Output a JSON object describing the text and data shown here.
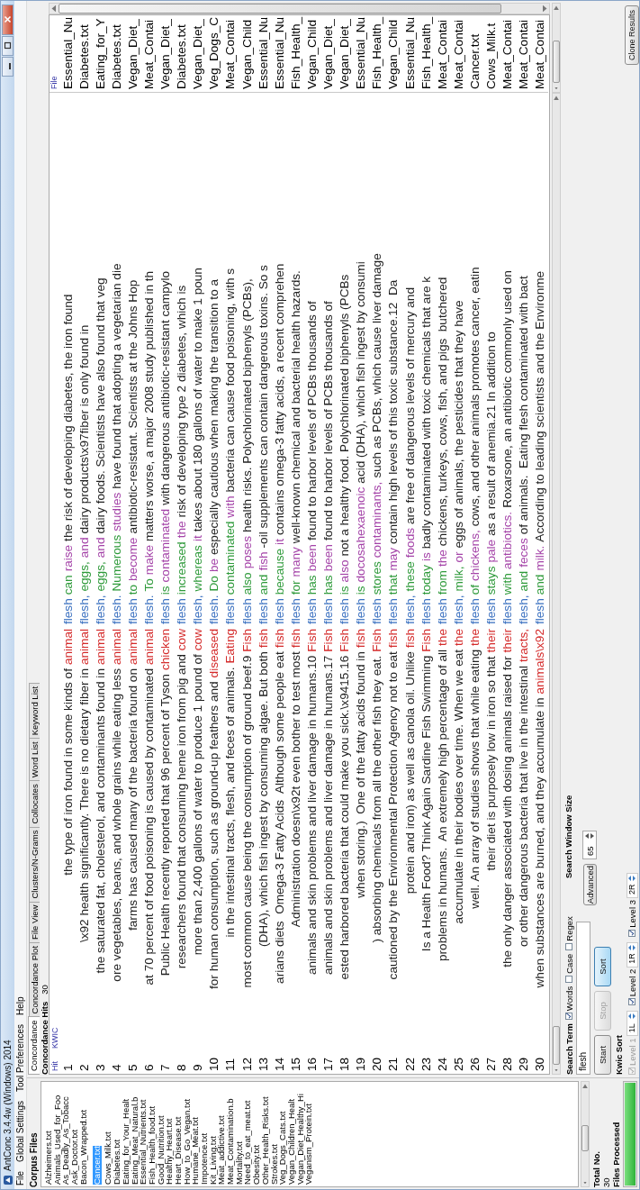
{
  "window": {
    "title": "AntConc 3.4.4w (Windows) 2014"
  },
  "menu": [
    "File",
    "Global Settings",
    "Tool Preferences",
    "Help"
  ],
  "corpus_files": {
    "label": "Corpus Files",
    "items": [
      {
        "name": "Alzheimers.txt",
        "selected": false
      },
      {
        "name": "Animals_Used_for_Foo",
        "selected": false
      },
      {
        "name": "As_Deadly_As_Tobacc",
        "selected": false
      },
      {
        "name": "Ask_Doctor.txt",
        "selected": false
      },
      {
        "name": "Bacon_Wrapped.txt",
        "selected": false
      },
      {
        "name": "Cancer.txt",
        "selected": true
      },
      {
        "name": "Cows_Milk.txt",
        "selected": false
      },
      {
        "name": "Diabetes.txt",
        "selected": false
      },
      {
        "name": "Eating_for_Your_Healt",
        "selected": false
      },
      {
        "name": "Eating_Meat_Natural.b",
        "selected": false
      },
      {
        "name": "Essential_Nutrients.txt",
        "selected": false
      },
      {
        "name": "Fish_Health_food.txt",
        "selected": false
      },
      {
        "name": "Good_Nutrition.txt",
        "selected": false
      },
      {
        "name": "Healthy_Heart.txt",
        "selected": false
      },
      {
        "name": "Heart_Disease.txt",
        "selected": false
      },
      {
        "name": "How_to_Go_Vegan.txt",
        "selected": false
      },
      {
        "name": "Humane_Meat.txt",
        "selected": false
      },
      {
        "name": "Impotence.txt",
        "selected": false
      },
      {
        "name": "Kit_Living.txt",
        "selected": false
      },
      {
        "name": "Meat_addictive.txt",
        "selected": false
      },
      {
        "name": "Meat_Contamination.b",
        "selected": false
      },
      {
        "name": "Mortality.txt",
        "selected": false
      },
      {
        "name": "Need_to_eat_meat.txt",
        "selected": false
      },
      {
        "name": "Obesity.txt",
        "selected": false
      },
      {
        "name": "Other_Health_Risks.txt",
        "selected": false
      },
      {
        "name": "Strokes.txt",
        "selected": false
      },
      {
        "name": "Veg_Dogs_Cats.txt",
        "selected": false
      },
      {
        "name": "Vegan_Children_Healt",
        "selected": false
      },
      {
        "name": "Vegan_Diet_Healthy_Hi",
        "selected": false
      },
      {
        "name": "Veganism_Protein.txt",
        "selected": false
      }
    ]
  },
  "totals": {
    "total_label": "Total No.",
    "total": "30",
    "processed_label": "Files Processed",
    "progress": {
      "level": 1
    }
  },
  "tabs": [
    {
      "label": "Concordance",
      "selected": true
    },
    {
      "label": "Concordance Plot",
      "selected": false
    },
    {
      "label": "File View",
      "selected": false
    },
    {
      "label": "Clusters/N-Grams",
      "selected": false
    },
    {
      "label": "Collocates",
      "selected": false
    },
    {
      "label": "Word List",
      "selected": false
    },
    {
      "label": "Keyword List",
      "selected": false
    }
  ],
  "concordance": {
    "hits_label": "Concordance Hits",
    "hits": "30",
    "columns": {
      "hit": "Hit",
      "kwic": "KWIC",
      "file": "File"
    },
    "rows": [
      {
        "hit": "1",
        "file": "Essential_Nu",
        "segments": [
          {
            "kind": "plain",
            "text": "the type of iron found in some kinds of"
          },
          {
            "kind": "l1",
            "text": "animal"
          },
          {
            "kind": "node",
            "text": "flesh"
          },
          {
            "kind": "r1",
            "text": "can"
          },
          {
            "kind": "r2",
            "text": "raise"
          },
          {
            "kind": "plain",
            "text": "the risk of developing diabetes, the iron found"
          }
        ]
      },
      {
        "hit": "2",
        "file": "Diabetes.txt",
        "segments": [
          {
            "kind": "plain",
            "text": "\\x92 health significantly. There is no dietary fiber in"
          },
          {
            "kind": "l1",
            "text": "animal"
          },
          {
            "kind": "node",
            "text": "flesh,"
          },
          {
            "kind": "r1",
            "text": "eggs,"
          },
          {
            "kind": "r2",
            "text": "and"
          },
          {
            "kind": "plain",
            "text": "dairy products\\x97fiber is only found in"
          }
        ]
      },
      {
        "hit": "3",
        "file": "Eating_for_Y",
        "segments": [
          {
            "kind": "plain",
            "text": "the saturated fat, cholesterol, and contaminants found in"
          },
          {
            "kind": "l1",
            "text": "animal"
          },
          {
            "kind": "node",
            "text": "flesh,"
          },
          {
            "kind": "r1",
            "text": "eggs,"
          },
          {
            "kind": "r2",
            "text": "and"
          },
          {
            "kind": "plain",
            "text": "dairy foods. Scientists have also found that veg"
          }
        ]
      },
      {
        "hit": "4",
        "file": "Diabetes.txt",
        "segments": [
          {
            "kind": "plain",
            "text": "ore vegetables, beans, and whole grains while eating less"
          },
          {
            "kind": "l1",
            "text": "animal"
          },
          {
            "kind": "node",
            "text": "flesh."
          },
          {
            "kind": "r1",
            "text": "Numerous"
          },
          {
            "kind": "r2",
            "text": "studies"
          },
          {
            "kind": "plain",
            "text": "have found that adopting a vegetarian die"
          }
        ]
      },
      {
        "hit": "5",
        "file": "Vegan_Diet_",
        "segments": [
          {
            "kind": "plain",
            "text": "farms has caused many of the bacteria found on"
          },
          {
            "kind": "l1",
            "text": "animal"
          },
          {
            "kind": "node",
            "text": "flesh"
          },
          {
            "kind": "r1",
            "text": "to"
          },
          {
            "kind": "r2",
            "text": "become"
          },
          {
            "kind": "plain",
            "text": "antibiotic-resistant. Scientists at the Johns Hop"
          }
        ]
      },
      {
        "hit": "6",
        "file": "Meat_Contai",
        "segments": [
          {
            "kind": "plain",
            "text": "at 70 percent of food poisoning is caused by contaminated"
          },
          {
            "kind": "l1",
            "text": "animal"
          },
          {
            "kind": "node",
            "text": "flesh."
          },
          {
            "kind": "r1",
            "text": "To"
          },
          {
            "kind": "r2",
            "text": "make"
          },
          {
            "kind": "plain",
            "text": "matters worse, a major 2008 study published in th"
          }
        ]
      },
      {
        "hit": "7",
        "file": "Vegan_Diet_",
        "segments": [
          {
            "kind": "plain",
            "text": "Public Health recently reported that 96 percent of Tyson"
          },
          {
            "kind": "l1",
            "text": "chicken"
          },
          {
            "kind": "node",
            "text": "flesh"
          },
          {
            "kind": "r1",
            "text": "is"
          },
          {
            "kind": "r2",
            "text": "contaminated"
          },
          {
            "kind": "plain",
            "text": "with dangerous antibiotic-resistant campylo"
          }
        ]
      },
      {
        "hit": "8",
        "file": "Diabetes.txt",
        "segments": [
          {
            "kind": "plain",
            "text": "researchers found that consuming heme iron from pig and"
          },
          {
            "kind": "l1",
            "text": "cow"
          },
          {
            "kind": "node",
            "text": "flesh"
          },
          {
            "kind": "r1",
            "text": "increased"
          },
          {
            "kind": "r2",
            "text": "the"
          },
          {
            "kind": "plain",
            "text": "risk of developing type 2 diabetes, which is"
          }
        ]
      },
      {
        "hit": "9",
        "file": "Vegan_Diet_",
        "segments": [
          {
            "kind": "plain",
            "text": "more than 2,400 gallons of water to produce 1 pound of"
          },
          {
            "kind": "l1",
            "text": "cow"
          },
          {
            "kind": "node",
            "text": "flesh,"
          },
          {
            "kind": "r1",
            "text": "whereas"
          },
          {
            "kind": "r2",
            "text": "it"
          },
          {
            "kind": "plain",
            "text": "takes about 180 gallons of water to make 1 poun"
          }
        ]
      },
      {
        "hit": "10",
        "file": "Veg_Dogs_C",
        "segments": [
          {
            "kind": "plain",
            "text": "for human consumption, such as ground-up feathers and"
          },
          {
            "kind": "l1",
            "text": "diseased"
          },
          {
            "kind": "node",
            "text": "flesh."
          },
          {
            "kind": "r1",
            "text": "Do"
          },
          {
            "kind": "r2",
            "text": "be"
          },
          {
            "kind": "plain",
            "text": "especially cautious when making the transition to a"
          }
        ]
      },
      {
        "hit": "11",
        "file": "Meat_Contai",
        "segments": [
          {
            "kind": "plain",
            "text": "in the intestinal tracts, flesh, and feces of animals."
          },
          {
            "kind": "l1",
            "text": "Eating"
          },
          {
            "kind": "node",
            "text": "flesh"
          },
          {
            "kind": "r1",
            "text": "contaminated"
          },
          {
            "kind": "r2",
            "text": "with"
          },
          {
            "kind": "plain",
            "text": "bacteria can cause food poisoning, with s"
          }
        ]
      },
      {
        "hit": "12",
        "file": "Vegan_Child",
        "segments": [
          {
            "kind": "plain",
            "text": "most common cause being the consumption of ground beef.9"
          },
          {
            "kind": "l1",
            "text": "Fish"
          },
          {
            "kind": "node",
            "text": "flesh"
          },
          {
            "kind": "r1",
            "text": "also"
          },
          {
            "kind": "r2",
            "text": "poses"
          },
          {
            "kind": "plain",
            "text": "health risks. Polychlorinated biphenyls (PCBs),"
          }
        ]
      },
      {
        "hit": "13",
        "file": "Essential_Nu",
        "segments": [
          {
            "kind": "plain",
            "text": "(DHA), which fish ingest by consuming algae. But both"
          },
          {
            "kind": "l1",
            "text": "fish"
          },
          {
            "kind": "node",
            "text": "flesh"
          },
          {
            "kind": "r1",
            "text": "and"
          },
          {
            "kind": "r2",
            "text": "fish"
          },
          {
            "kind": "plain",
            "text": "-oil supplements can contain dangerous toxins. So s"
          }
        ]
      },
      {
        "hit": "14",
        "file": "Essential_Nu",
        "segments": [
          {
            "kind": "plain",
            "text": "arians diets  Omega-3 Fatty Acids  Although some people eat"
          },
          {
            "kind": "l1",
            "text": "fish"
          },
          {
            "kind": "node",
            "text": "flesh"
          },
          {
            "kind": "r1",
            "text": "because"
          },
          {
            "kind": "r2",
            "text": "it"
          },
          {
            "kind": "plain",
            "text": "contains omega-3 fatty acids, a recent comprehen"
          }
        ]
      },
      {
        "hit": "15",
        "file": "Fish_Health_",
        "segments": [
          {
            "kind": "plain",
            "text": "Administration doesn\\x92t even bother to test most"
          },
          {
            "kind": "l1",
            "text": "fish"
          },
          {
            "kind": "node",
            "text": "flesh"
          },
          {
            "kind": "r1",
            "text": "for"
          },
          {
            "kind": "r2",
            "text": "many"
          },
          {
            "kind": "plain",
            "text": "well-known chemical and bacterial health hazards."
          }
        ]
      },
      {
        "hit": "16",
        "file": "Vegan_Child",
        "segments": [
          {
            "kind": "plain",
            "text": "animals and skin problems and liver damage in humans.10"
          },
          {
            "kind": "l1",
            "text": "Fish"
          },
          {
            "kind": "node",
            "text": "flesh"
          },
          {
            "kind": "r1",
            "text": "has"
          },
          {
            "kind": "r2",
            "text": "been"
          },
          {
            "kind": "plain",
            "text": "found to harbor levels of PCBs thousands of"
          }
        ]
      },
      {
        "hit": "17",
        "file": "Vegan_Diet_",
        "segments": [
          {
            "kind": "plain",
            "text": "animals and skin problems and liver damage in humans.17"
          },
          {
            "kind": "l1",
            "text": "Fish"
          },
          {
            "kind": "node",
            "text": "flesh"
          },
          {
            "kind": "r1",
            "text": "has"
          },
          {
            "kind": "r2",
            "text": "been"
          },
          {
            "kind": "plain",
            "text": "found to harbor levels of PCBs thousands of"
          }
        ]
      },
      {
        "hit": "18",
        "file": "Vegan_Diet_",
        "segments": [
          {
            "kind": "plain",
            "text": "ested harbored bacteria that could make you sick.\\x9415.16"
          },
          {
            "kind": "l1",
            "text": "Fish"
          },
          {
            "kind": "node",
            "text": "flesh"
          },
          {
            "kind": "r1",
            "text": "is"
          },
          {
            "kind": "r2",
            "text": "also"
          },
          {
            "kind": "plain",
            "text": "not a healthy food. Polychlorinated biphenyls (PCBs"
          }
        ]
      },
      {
        "hit": "19",
        "file": "Essential_Nu",
        "segments": [
          {
            "kind": "plain",
            "text": "when storing.)  One of the fatty acids found in"
          },
          {
            "kind": "l1",
            "text": "fish"
          },
          {
            "kind": "node",
            "text": "flesh"
          },
          {
            "kind": "r1",
            "text": "is"
          },
          {
            "kind": "r2",
            "text": "docosahexaenoic"
          },
          {
            "kind": "plain",
            "text": "acid (DHA), which fish ingest by consumi"
          }
        ]
      },
      {
        "hit": "20",
        "file": "Fish_Health_",
        "segments": [
          {
            "kind": "plain",
            "text": ") absorbing chemicals from all the other fish they eat."
          },
          {
            "kind": "l1",
            "text": "Fish"
          },
          {
            "kind": "node",
            "text": "flesh"
          },
          {
            "kind": "r1",
            "text": "stores"
          },
          {
            "kind": "r2",
            "text": "contaminants,"
          },
          {
            "kind": "plain",
            "text": "such as PCBs, which cause liver damage"
          }
        ]
      },
      {
        "hit": "21",
        "file": "Vegan_Child",
        "segments": [
          {
            "kind": "plain",
            "text": "cautioned by the Environmental Protection Agency not to eat"
          },
          {
            "kind": "l1",
            "text": "fish"
          },
          {
            "kind": "node",
            "text": "flesh"
          },
          {
            "kind": "r1",
            "text": "that"
          },
          {
            "kind": "r2",
            "text": "may"
          },
          {
            "kind": "plain",
            "text": "contain high levels of this toxic substance.12  Da"
          }
        ]
      },
      {
        "hit": "22",
        "file": "Essential_Nu",
        "segments": [
          {
            "kind": "plain",
            "text": "protein and iron) as well as canola oil. Unlike"
          },
          {
            "kind": "l1",
            "text": "fish"
          },
          {
            "kind": "node",
            "text": "flesh,"
          },
          {
            "kind": "r1",
            "text": "these"
          },
          {
            "kind": "r2",
            "text": "foods"
          },
          {
            "kind": "plain",
            "text": "are free of dangerous levels of mercury and"
          }
        ]
      },
      {
        "hit": "23",
        "file": "Fish_Health_",
        "segments": [
          {
            "kind": "plain",
            "text": "Is a Health Food? Think Again Sardine Fish Swimming"
          },
          {
            "kind": "l1",
            "text": "Fish"
          },
          {
            "kind": "node",
            "text": "flesh"
          },
          {
            "kind": "r1",
            "text": "today"
          },
          {
            "kind": "r2",
            "text": "is"
          },
          {
            "kind": "plain",
            "text": "badly contaminated with toxic chemicals that are k"
          }
        ]
      },
      {
        "hit": "24",
        "file": "Meat_Contai",
        "segments": [
          {
            "kind": "plain",
            "text": "problems in humans.  An extremely high percentage of all"
          },
          {
            "kind": "l1",
            "text": "the"
          },
          {
            "kind": "node",
            "text": "flesh"
          },
          {
            "kind": "r1",
            "text": "from"
          },
          {
            "kind": "r2",
            "text": "the"
          },
          {
            "kind": "plain",
            "text": "chickens, turkeys, cows, fish, and pigs  butchered"
          }
        ]
      },
      {
        "hit": "25",
        "file": "Meat_Contai",
        "segments": [
          {
            "kind": "plain",
            "text": "accumulate in their bodies over time. When we eat"
          },
          {
            "kind": "l1",
            "text": "the"
          },
          {
            "kind": "node",
            "text": "flesh,"
          },
          {
            "kind": "r1",
            "text": "milk,"
          },
          {
            "kind": "r2",
            "text": "or"
          },
          {
            "kind": "plain",
            "text": "eggs of animals, the pesticides that they have"
          }
        ]
      },
      {
        "hit": "26",
        "file": "Cancer.txt",
        "segments": [
          {
            "kind": "plain",
            "text": "well. An array of studies shows that while eating"
          },
          {
            "kind": "l1",
            "text": "the"
          },
          {
            "kind": "node",
            "text": "flesh"
          },
          {
            "kind": "r1",
            "text": "of"
          },
          {
            "kind": "r2",
            "text": "chickens,"
          },
          {
            "kind": "plain",
            "text": "cows, and other animals promotes cancer, eatin"
          }
        ]
      },
      {
        "hit": "27",
        "file": "Cows_Milk.t",
        "segments": [
          {
            "kind": "plain",
            "text": "their diet is purposely low in iron so that"
          },
          {
            "kind": "l1",
            "text": "their"
          },
          {
            "kind": "node",
            "text": "flesh"
          },
          {
            "kind": "r1",
            "text": "stays"
          },
          {
            "kind": "r2",
            "text": "pale"
          },
          {
            "kind": "plain",
            "text": "as a result of anemia.21 In addition to"
          }
        ]
      },
      {
        "hit": "28",
        "file": "Meat_Contai",
        "segments": [
          {
            "kind": "plain",
            "text": "the only danger associated with dosing animals raised for"
          },
          {
            "kind": "l1",
            "text": "their"
          },
          {
            "kind": "node",
            "text": "flesh"
          },
          {
            "kind": "r1",
            "text": "with"
          },
          {
            "kind": "r2",
            "text": "antibiotics."
          },
          {
            "kind": "plain",
            "text": "Roxarsone, an antibiotic commonly used on"
          }
        ]
      },
      {
        "hit": "29",
        "file": "Meat_Contai",
        "segments": [
          {
            "kind": "plain",
            "text": "or other dangerous bacteria that live in the intestinal"
          },
          {
            "kind": "l1",
            "text": "tracts,"
          },
          {
            "kind": "node",
            "text": "flesh,"
          },
          {
            "kind": "r1",
            "text": "and"
          },
          {
            "kind": "r2",
            "text": "feces"
          },
          {
            "kind": "plain",
            "text": "of animals.  Eating flesh contaminated with bact"
          }
        ]
      },
      {
        "hit": "30",
        "file": "Meat_Contai",
        "segments": [
          {
            "kind": "plain",
            "text": "when substances are burned, and they accumulate in"
          },
          {
            "kind": "l1",
            "text": "animals\\x92"
          },
          {
            "kind": "node",
            "text": "flesh"
          },
          {
            "kind": "r1",
            "text": "and"
          },
          {
            "kind": "r2",
            "text": "milk."
          },
          {
            "kind": "plain",
            "text": "According to leading scientists and the Environme"
          }
        ]
      }
    ]
  },
  "search": {
    "label": "Search Term",
    "options": [
      {
        "label": "Words",
        "checked": true
      },
      {
        "label": "Case",
        "checked": false
      },
      {
        "label": "Regex",
        "checked": false
      }
    ],
    "value": "flesh",
    "advanced": "Advanced",
    "window_size_label": "Search Window Size",
    "window_size": "65"
  },
  "buttons": [
    {
      "label": "Start",
      "disabled": false,
      "selected": false
    },
    {
      "label": "Stop",
      "disabled": true,
      "selected": false
    },
    {
      "label": "Sort",
      "disabled": false,
      "selected": true
    }
  ],
  "kwic_sort": {
    "label": "Kwic Sort",
    "levels": [
      {
        "label": "Level 1",
        "checked": true,
        "disabled": true,
        "value": "1L"
      },
      {
        "label": "Level 2",
        "checked": true,
        "disabled": false,
        "value": "1R"
      },
      {
        "label": "Level 3",
        "checked": true,
        "disabled": false,
        "value": "2R"
      }
    ]
  },
  "clone_button": "Clone Results"
}
